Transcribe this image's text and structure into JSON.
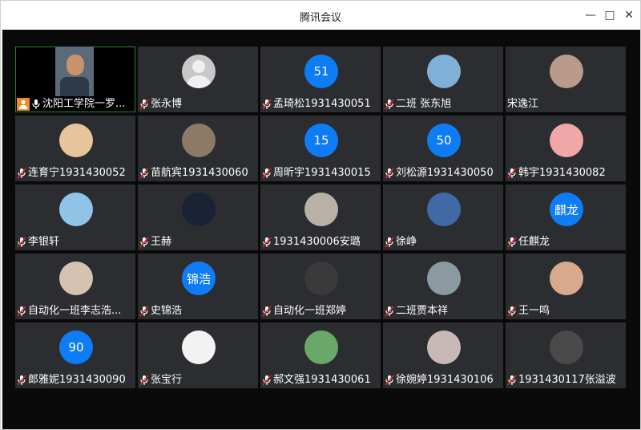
{
  "window": {
    "title": "腾讯会议",
    "minimize_glyph": "—",
    "maximize_glyph": "□",
    "close_glyph": "✕"
  },
  "participants": [
    {
      "name": "沈阳工学院一罗...",
      "avatar": "video",
      "host": true
    },
    {
      "name": "张永博",
      "avatar": "default"
    },
    {
      "name": "孟琦松1931430051",
      "avatar": "text",
      "avatar_text": "51"
    },
    {
      "name": "二班 张东旭",
      "avatar": "pic",
      "color": "#7fb1d8"
    },
    {
      "name": "宋逸江",
      "avatar": "pic",
      "color": "#b89b8a",
      "no_mic": true
    },
    {
      "name": "连育宁1931430052",
      "avatar": "pic",
      "color": "#e7c59a"
    },
    {
      "name": "苗航宾1931430060",
      "avatar": "pic",
      "color": "#8c7a66"
    },
    {
      "name": "周昕宇1931430015",
      "avatar": "text",
      "avatar_text": "15"
    },
    {
      "name": "刘松源1931430050",
      "avatar": "text",
      "avatar_text": "50"
    },
    {
      "name": "韩宇1931430082",
      "avatar": "pic",
      "color": "#f0a7a7"
    },
    {
      "name": "李银轩",
      "avatar": "pic",
      "color": "#8fc4e8"
    },
    {
      "name": "王赫",
      "avatar": "pic",
      "color": "#1b2236"
    },
    {
      "name": "1931430006安璐",
      "avatar": "pic",
      "color": "#b7b1a6"
    },
    {
      "name": "徐峥",
      "avatar": "pic",
      "color": "#3f6aa5"
    },
    {
      "name": "任麒龙",
      "avatar": "text",
      "avatar_text": "麒龙"
    },
    {
      "name": "自动化一班李志浩...",
      "avatar": "pic",
      "color": "#d6c2b0"
    },
    {
      "name": "史锦浩",
      "avatar": "text",
      "avatar_text": "锦浩"
    },
    {
      "name": "自动化一班郑婷",
      "avatar": "pic",
      "color": "#3a3a3a"
    },
    {
      "name": "二班贾本祥",
      "avatar": "pic",
      "color": "#8a9aa0"
    },
    {
      "name": "王一鸣",
      "avatar": "pic",
      "color": "#d8a98a"
    },
    {
      "name": "郎雅妮1931430090",
      "avatar": "text",
      "avatar_text": "90"
    },
    {
      "name": "张宝行",
      "avatar": "pic",
      "color": "#f2f2f2"
    },
    {
      "name": "郝文强1931430061",
      "avatar": "pic",
      "color": "#6aa76a"
    },
    {
      "name": "徐婉婷1931430106",
      "avatar": "pic",
      "color": "#c9b8b8"
    },
    {
      "name": "1931430117张溢波",
      "avatar": "pic",
      "color": "#4a4a4a"
    }
  ],
  "colors": {
    "accent": "#0e7cf4",
    "tile_bg": "#2b2d30",
    "content_bg": "#0a0a0a",
    "mic_muted": "#e0242a",
    "host_badge": "#f08a24"
  }
}
